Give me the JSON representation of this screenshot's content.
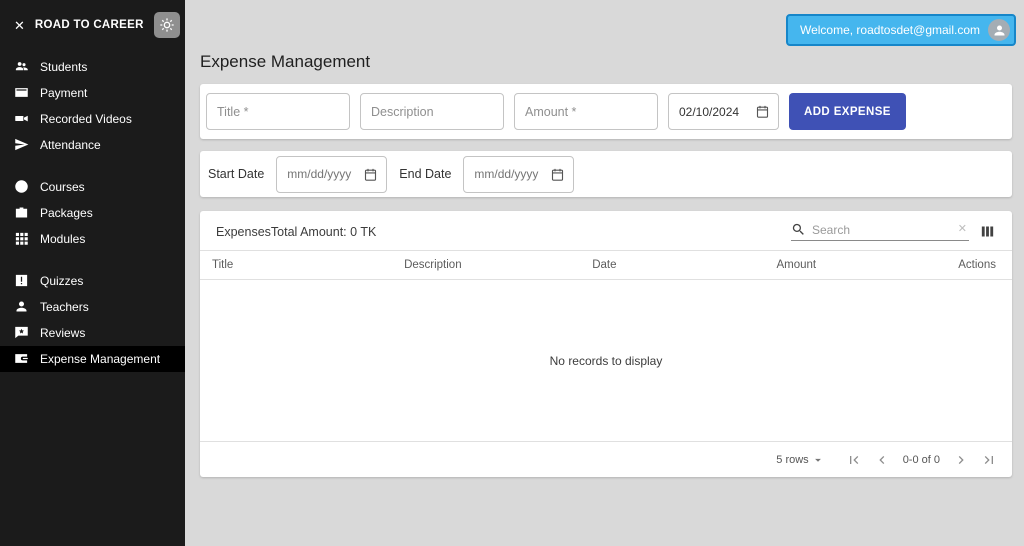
{
  "sidebar": {
    "title": "ROAD TO CAREER",
    "items": [
      {
        "label": "Students"
      },
      {
        "label": "Payment"
      },
      {
        "label": "Recorded Videos"
      },
      {
        "label": "Attendance"
      },
      {
        "label": "Courses"
      },
      {
        "label": "Packages"
      },
      {
        "label": "Modules"
      },
      {
        "label": "Quizzes"
      },
      {
        "label": "Teachers"
      },
      {
        "label": "Reviews"
      },
      {
        "label": "Expense Management"
      }
    ]
  },
  "icons": {
    "close": "✕",
    "clear": "✕"
  },
  "header": {
    "welcome": "Welcome, roadtosdet@gmail.com"
  },
  "page": {
    "title": "Expense Management"
  },
  "form": {
    "title_placeholder": "Title *",
    "description_placeholder": "Description",
    "amount_placeholder": "Amount *",
    "date_value": "02/10/2024",
    "add_button": "ADD EXPENSE"
  },
  "filters": {
    "start_date_label": "Start Date",
    "end_date_label": "End Date",
    "start_date_placeholder": "mm/dd/yyyy",
    "end_date_placeholder": "mm/dd/yyyy"
  },
  "table": {
    "title": "Expenses",
    "total": "Total Amount: 0 TK",
    "search_placeholder": "Search",
    "columns": [
      "Title",
      "Description",
      "Date",
      "Amount",
      "Actions"
    ],
    "empty_text": "No records to display",
    "rows_label": "5 rows",
    "range_label": "0-0 of 0"
  },
  "colors": {
    "accent": "#3f51b5",
    "banner": "#45b6ee",
    "sidebar_bg": "#1b1b1b",
    "active_item_bg": "#000000"
  }
}
